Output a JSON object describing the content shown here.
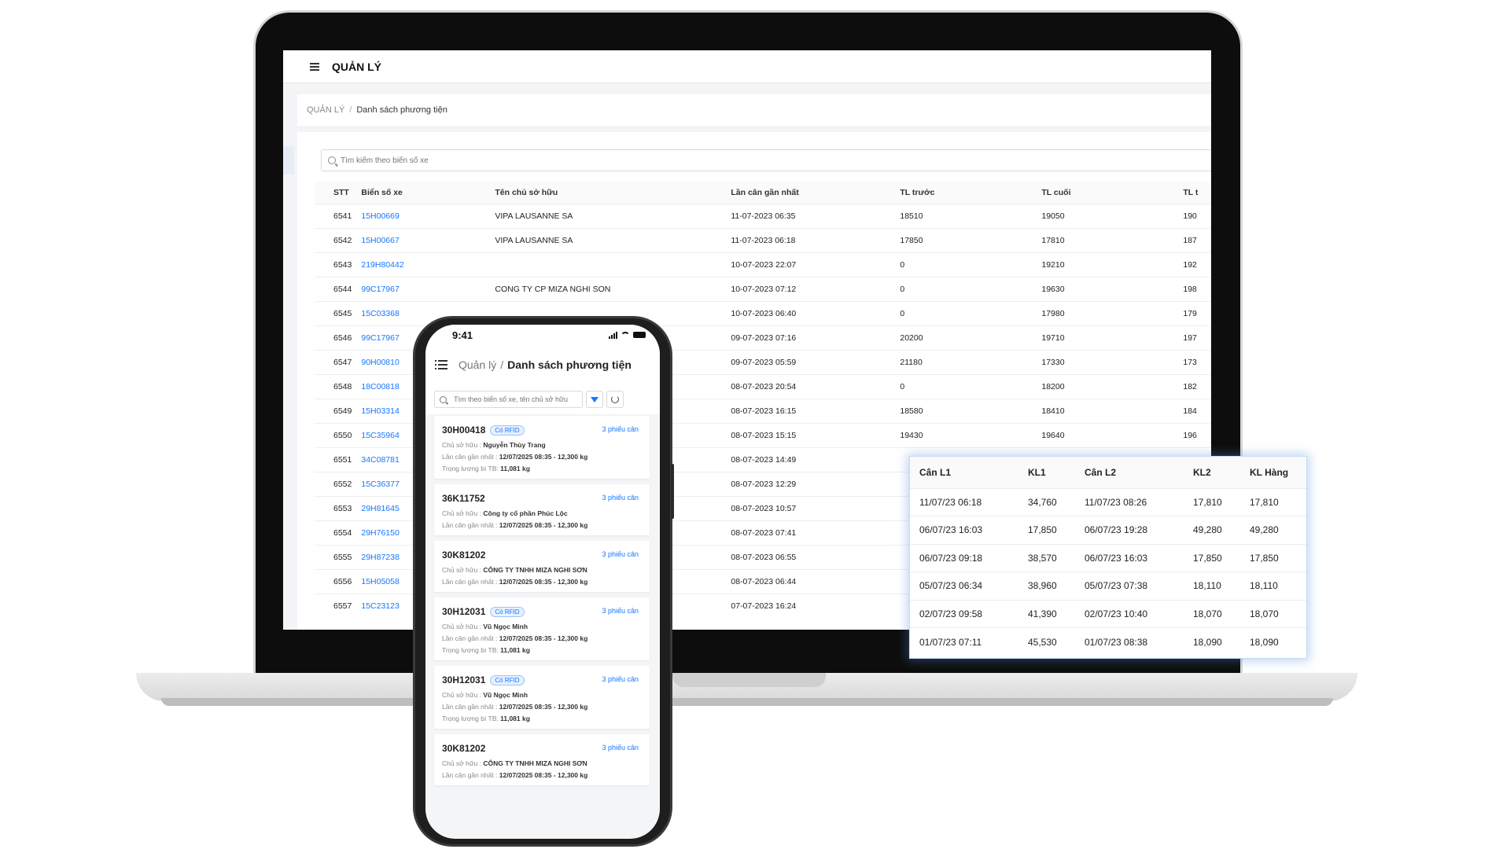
{
  "desktop": {
    "app_title": "QUẢN LÝ",
    "breadcrumb": {
      "root": "QUẢN LÝ",
      "separator": "/",
      "current": "Danh sách phương tiện"
    },
    "search_placeholder": "Tìm kiếm theo biển số xe",
    "table": {
      "headers": {
        "stt": "STT",
        "plate": "Biển số xe",
        "owner": "Tên chủ sở hữu",
        "last_weigh": "Lần cân gần nhất",
        "tl_truoc": "TL trước",
        "tl_cuoi": "TL cuối",
        "tl_cut": "TL t"
      },
      "rows": [
        {
          "stt": "6541",
          "plate": "15H00669",
          "owner": "VIPA LAUSANNE SA",
          "last": "11-07-2023 06:35",
          "tl_truoc": "18510",
          "tl_cuoi": "19050",
          "tl_cut": "190"
        },
        {
          "stt": "6542",
          "plate": "15H00667",
          "owner": "VIPA LAUSANNE SA",
          "last": "11-07-2023 06:18",
          "tl_truoc": "17850",
          "tl_cuoi": "17810",
          "tl_cut": "187"
        },
        {
          "stt": "6543",
          "plate": "219H80442",
          "owner": "",
          "last": "10-07-2023 22:07",
          "tl_truoc": "0",
          "tl_cuoi": "19210",
          "tl_cut": "192"
        },
        {
          "stt": "6544",
          "plate": "99C17967",
          "owner": "CONG TY CP MIZA NGHI SON",
          "last": "10-07-2023 07:12",
          "tl_truoc": "0",
          "tl_cuoi": "19630",
          "tl_cut": "198"
        },
        {
          "stt": "6545",
          "plate": "15C03368",
          "owner": "",
          "last": "10-07-2023 06:40",
          "tl_truoc": "0",
          "tl_cuoi": "17980",
          "tl_cut": "179"
        },
        {
          "stt": "6546",
          "plate": "99C17967",
          "owner": "",
          "last": "09-07-2023 07:16",
          "tl_truoc": "20200",
          "tl_cuoi": "19710",
          "tl_cut": "197"
        },
        {
          "stt": "6547",
          "plate": "90H00810",
          "owner": "",
          "last": "09-07-2023 05:59",
          "tl_truoc": "21180",
          "tl_cuoi": "17330",
          "tl_cut": "173"
        },
        {
          "stt": "6548",
          "plate": "18C00818",
          "owner": "",
          "last": "08-07-2023 20:54",
          "tl_truoc": "0",
          "tl_cuoi": "18200",
          "tl_cut": "182"
        },
        {
          "stt": "6549",
          "plate": "15H03314",
          "owner": "",
          "last": "08-07-2023 16:15",
          "tl_truoc": "18580",
          "tl_cuoi": "18410",
          "tl_cut": "184"
        },
        {
          "stt": "6550",
          "plate": "15C35964",
          "owner": "",
          "last": "08-07-2023 15:15",
          "tl_truoc": "19430",
          "tl_cuoi": "19640",
          "tl_cut": "196"
        },
        {
          "stt": "6551",
          "plate": "34C08781",
          "owner": "",
          "last": "08-07-2023 14:49",
          "tl_truoc": "",
          "tl_cuoi": "",
          "tl_cut": ""
        },
        {
          "stt": "6552",
          "plate": "15C36377",
          "owner": "",
          "last": "08-07-2023 12:29",
          "tl_truoc": "",
          "tl_cuoi": "",
          "tl_cut": ""
        },
        {
          "stt": "6553",
          "plate": "29H81645",
          "owner": "",
          "last": "08-07-2023 10:57",
          "tl_truoc": "",
          "tl_cuoi": "",
          "tl_cut": ""
        },
        {
          "stt": "6554",
          "plate": "29H76150",
          "owner": "",
          "last": "08-07-2023 07:41",
          "tl_truoc": "",
          "tl_cuoi": "",
          "tl_cut": ""
        },
        {
          "stt": "6555",
          "plate": "29H87238",
          "owner": "",
          "last": "08-07-2023 06:55",
          "tl_truoc": "",
          "tl_cuoi": "",
          "tl_cut": ""
        },
        {
          "stt": "6556",
          "plate": "15H05058",
          "owner": "",
          "last": "08-07-2023 06:44",
          "tl_truoc": "",
          "tl_cuoi": "",
          "tl_cut": ""
        },
        {
          "stt": "6557",
          "plate": "15C23123",
          "owner": "",
          "last": "07-07-2023 16:24",
          "tl_truoc": "",
          "tl_cuoi": "",
          "tl_cut": ""
        }
      ]
    }
  },
  "popup": {
    "headers": {
      "can_l1": "Cân L1",
      "kl1": "KL1",
      "can_l2": "Cân L2",
      "kl2": "KL2",
      "kl_hang": "KL Hàng"
    },
    "rows": [
      {
        "can_l1": "11/07/23 06:18",
        "kl1": "34,760",
        "can_l2": "11/07/23 08:26",
        "kl2": "17,810",
        "kl_hang": "17,810"
      },
      {
        "can_l1": "06/07/23 16:03",
        "kl1": "17,850",
        "can_l2": "06/07/23 19:28",
        "kl2": "49,280",
        "kl_hang": "49,280"
      },
      {
        "can_l1": "06/07/23 09:18",
        "kl1": "38,570",
        "can_l2": "06/07/23 16:03",
        "kl2": "17,850",
        "kl_hang": "17,850"
      },
      {
        "can_l1": "05/07/23 06:34",
        "kl1": "38,960",
        "can_l2": "05/07/23 07:38",
        "kl2": "18,110",
        "kl_hang": "18,110"
      },
      {
        "can_l1": "02/07/23 09:58",
        "kl1": "41,390",
        "can_l2": "02/07/23 10:40",
        "kl2": "18,070",
        "kl_hang": "18,070"
      },
      {
        "can_l1": "01/07/23 07:11",
        "kl1": "45,530",
        "can_l2": "01/07/23 08:38",
        "kl2": "18,090",
        "kl_hang": "18,090"
      }
    ]
  },
  "mobile": {
    "time": "9:41",
    "breadcrumb": {
      "root": "Quản lý",
      "separator": "/",
      "current": "Danh sách phương tiện"
    },
    "search_placeholder": "Tìm theo biển số xe, tên chủ sở hữu",
    "labels": {
      "owner": "Chủ sở hữu : ",
      "last": "Lần cân gần nhất : ",
      "tare": "Trọng lượng bì TB: "
    },
    "cards": [
      {
        "plate": "30H00418",
        "badge": "Có RFID",
        "tickets": "3 phiếu cân",
        "owner": "Nguyễn Thùy Trang",
        "last_time": "12/07/2025 08:35",
        "last_weight": "12,300 kg",
        "tare": "11,081 kg"
      },
      {
        "plate": "36K11752",
        "badge": "",
        "tickets": "3 phiếu cân",
        "owner": "Công ty cổ phần Phúc Lộc",
        "last_time": "12/07/2025 08:35",
        "last_weight": "12,300 kg",
        "tare": ""
      },
      {
        "plate": "30K81202",
        "badge": "",
        "tickets": "3 phiếu cân",
        "owner": "CÔNG TY TNHH MIZA NGHI SƠN",
        "last_time": "12/07/2025 08:35",
        "last_weight": "12,300 kg",
        "tare": ""
      },
      {
        "plate": "30H12031",
        "badge": "Có RFID",
        "tickets": "3 phiếu cân",
        "owner": "Vũ Ngọc Minh",
        "last_time": "12/07/2025 08:35",
        "last_weight": "12,300 kg",
        "tare": "11,081 kg"
      },
      {
        "plate": "30H12031",
        "badge": "Có RFID",
        "tickets": "3 phiếu cân",
        "owner": "Vũ Ngọc Minh",
        "last_time": "12/07/2025 08:35",
        "last_weight": "12,300 kg",
        "tare": "11,081 kg"
      },
      {
        "plate": "30K81202",
        "badge": "",
        "tickets": "3 phiếu cân",
        "owner": "CÔNG TY TNHH MIZA NGHI SƠN",
        "last_time": "12/07/2025 08:35",
        "last_weight": "12,300 kg",
        "tare": ""
      }
    ]
  }
}
